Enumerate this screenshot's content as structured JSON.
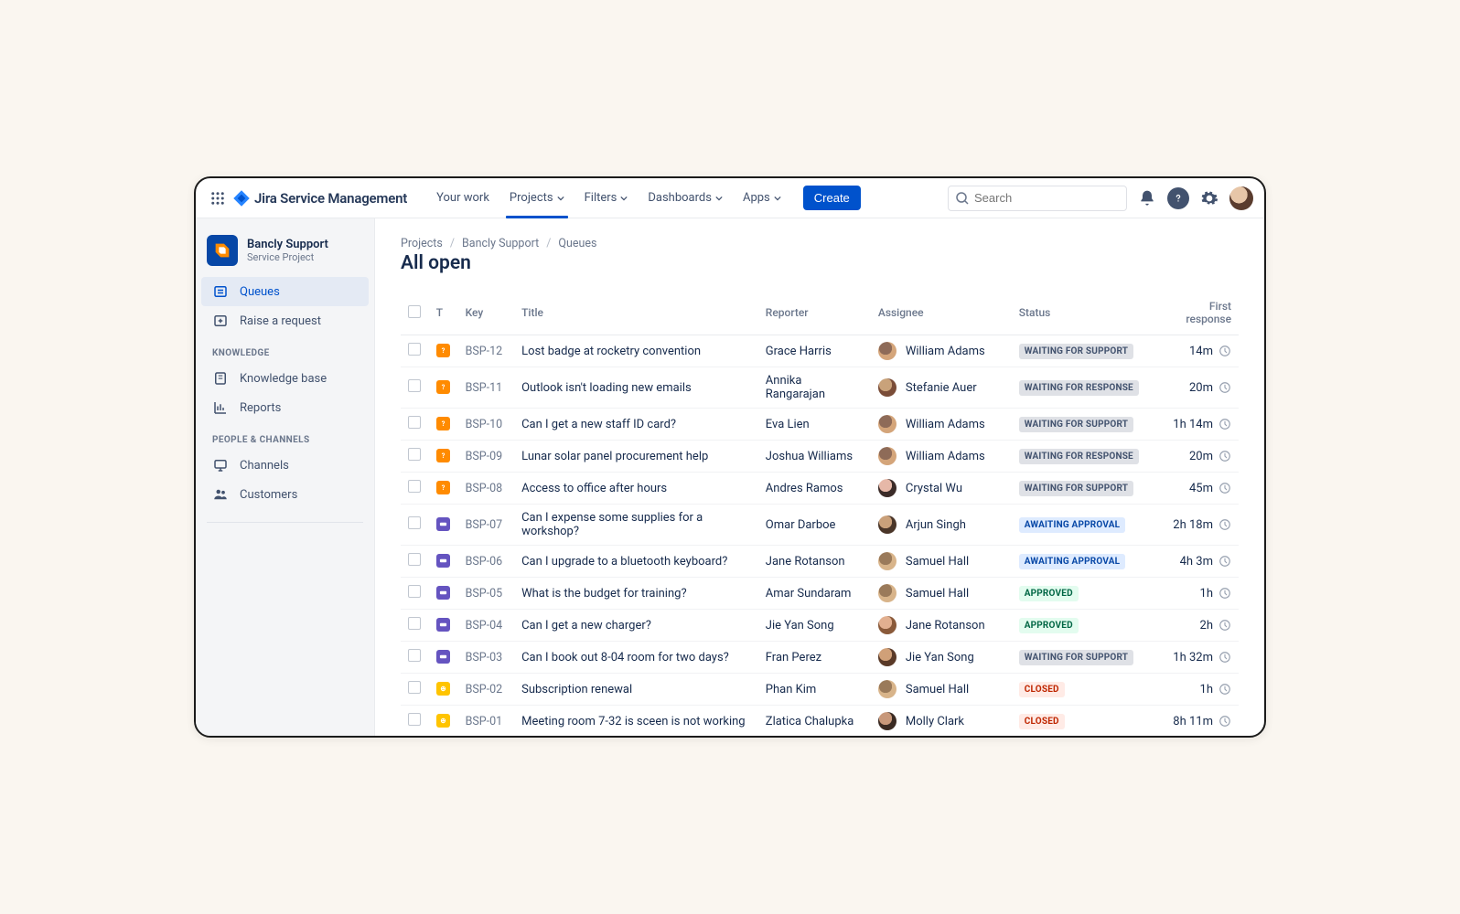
{
  "branding": {
    "product_name": "Jira Service Management"
  },
  "top_nav": {
    "your_work": "Your work",
    "projects": "Projects",
    "filters": "Filters",
    "dashboards": "Dashboards",
    "apps": "Apps",
    "create": "Create"
  },
  "search": {
    "placeholder": "Search"
  },
  "project": {
    "name": "Bancly Support",
    "subtitle": "Service Project"
  },
  "sidebar": {
    "queues": "Queues",
    "raise": "Raise a request",
    "section_knowledge": "KNOWLEDGE",
    "kb": "Knowledge base",
    "reports": "Reports",
    "section_people": "PEOPLE & CHANNELS",
    "channels": "Channels",
    "customers": "Customers"
  },
  "breadcrumbs": {
    "projects": "Projects",
    "bancly": "Bancly Support",
    "queues": "Queues"
  },
  "page": {
    "title": "All open"
  },
  "columns": {
    "type": "T",
    "key": "Key",
    "title": "Title",
    "reporter": "Reporter",
    "assignee": "Assignee",
    "status": "Status",
    "first_response": "First response"
  },
  "rows": [
    {
      "type": "orange",
      "key": "BSP-12",
      "title": "Lost badge at rocketry convention",
      "reporter": "Grace Harris",
      "assignee": "William Adams",
      "status_label": "WAITING FOR SUPPORT",
      "status_class": "waiting-support",
      "resp": "14m",
      "avatar": "wa"
    },
    {
      "type": "orange",
      "key": "BSP-11",
      "title": "Outlook isn't loading new emails",
      "reporter": "Annika Rangarajan",
      "assignee": "Stefanie Auer",
      "status_label": "WAITING FOR RESPONSE",
      "status_class": "waiting-response",
      "resp": "20m",
      "avatar": "sa"
    },
    {
      "type": "orange",
      "key": "BSP-10",
      "title": "Can I get a new staff ID card?",
      "reporter": "Eva Lien",
      "assignee": "William Adams",
      "status_label": "WAITING FOR SUPPORT",
      "status_class": "waiting-support",
      "resp": "1h 14m",
      "avatar": "wa"
    },
    {
      "type": "orange",
      "key": "BSP-09",
      "title": "Lunar solar panel procurement help",
      "reporter": "Joshua Williams",
      "assignee": "William Adams",
      "status_label": "WAITING FOR RESPONSE",
      "status_class": "waiting-response",
      "resp": "20m",
      "avatar": "wa"
    },
    {
      "type": "orange",
      "key": "BSP-08",
      "title": "Access to office after hours",
      "reporter": "Andres Ramos",
      "assignee": "Crystal Wu",
      "status_label": "WAITING FOR SUPPORT",
      "status_class": "waiting-support",
      "resp": "45m",
      "avatar": "cw"
    },
    {
      "type": "purple",
      "key": "BSP-07",
      "title": "Can I expense some supplies for a workshop?",
      "reporter": "Omar Darboe",
      "assignee": "Arjun Singh",
      "status_label": "AWAITING APPROVAL",
      "status_class": "awaiting-approval",
      "resp": "2h 18m",
      "avatar": "as"
    },
    {
      "type": "purple",
      "key": "BSP-06",
      "title": "Can I upgrade to a bluetooth keyboard?",
      "reporter": "Jane Rotanson",
      "assignee": "Samuel Hall",
      "status_label": "AWAITING APPROVAL",
      "status_class": "awaiting-approval",
      "resp": "4h 3m",
      "avatar": "sh"
    },
    {
      "type": "purple",
      "key": "BSP-05",
      "title": "What is the budget for training?",
      "reporter": "Amar Sundaram",
      "assignee": "Samuel Hall",
      "status_label": "APPROVED",
      "status_class": "approved",
      "resp": "1h",
      "avatar": "sh"
    },
    {
      "type": "purple",
      "key": "BSP-04",
      "title": "Can I get a new charger?",
      "reporter": "Jie Yan Song",
      "assignee": "Jane Rotanson",
      "status_label": "APPROVED",
      "status_class": "approved",
      "resp": "2h",
      "avatar": "jr"
    },
    {
      "type": "purple",
      "key": "BSP-03",
      "title": "Can I book out 8-04 room for two days?",
      "reporter": "Fran Perez",
      "assignee": "Jie Yan Song",
      "status_label": "WAITING FOR SUPPORT",
      "status_class": "waiting-support",
      "resp": "1h 32m",
      "avatar": "jy"
    },
    {
      "type": "yellow",
      "key": "BSP-02",
      "title": "Subscription renewal",
      "reporter": "Phan Kim",
      "assignee": "Samuel Hall",
      "status_label": "CLOSED",
      "status_class": "closed",
      "resp": "1h",
      "avatar": "sh"
    },
    {
      "type": "yellow",
      "key": "BSP-01",
      "title": "Meeting room 7-32 is sceen is not working",
      "reporter": "Zlatica Chalupka",
      "assignee": "Molly Clark",
      "status_label": "CLOSED",
      "status_class": "closed",
      "resp": "8h 11m",
      "avatar": "mc"
    }
  ],
  "avatar_colors": {
    "wa": [
      "#8e6b58",
      "#d4a57a"
    ],
    "sa": [
      "#c9a27a",
      "#7a4d38"
    ],
    "cw": [
      "#e6b8a8",
      "#3b2b28"
    ],
    "as": [
      "#caa07a",
      "#4a3528"
    ],
    "sh": [
      "#9a7a5a",
      "#d8b48a"
    ],
    "jr": [
      "#e2b090",
      "#8a5a3a"
    ],
    "jy": [
      "#d0a078",
      "#5a3a28"
    ],
    "mc": [
      "#c8987a",
      "#3a2a22"
    ]
  }
}
